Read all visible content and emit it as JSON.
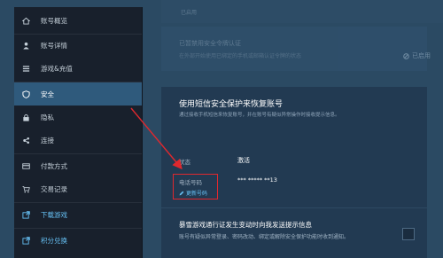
{
  "sidebar": {
    "items": [
      {
        "label": "账号概览",
        "icon": "home-icon"
      },
      {
        "label": "账号详情",
        "icon": "user-icon"
      },
      {
        "label": "游戏&充值",
        "icon": "list-icon"
      },
      {
        "label": "安全",
        "icon": "shield-icon"
      },
      {
        "label": "隐私",
        "icon": "lock-icon"
      },
      {
        "label": "连接",
        "icon": "link-icon"
      },
      {
        "label": "付款方式",
        "icon": "card-icon"
      },
      {
        "label": "交易记录",
        "icon": "cart-icon"
      },
      {
        "label": "下载游戏",
        "icon": "external-link-icon"
      },
      {
        "label": "积分兑换",
        "icon": "external-link-icon"
      }
    ],
    "active": "安全"
  },
  "background": {
    "top_label": "已启用",
    "card_title": "已暂禁用安全令牌认证",
    "card_sub": "在外部开始使用已绑定的手机或邮箱认证令牌的状态",
    "status": "已启用"
  },
  "recovery": {
    "title": "使用短信安全保护来恢复账号",
    "subtitle": "通过接收手机短信来恢复账号，并在账号有疑似异常操作时接收提示信息。",
    "status_label": "状态",
    "status_value": "激活",
    "phone_label": "电话号码",
    "phone_value": "*** ***** **13",
    "edit_label": "更新号码"
  },
  "notify": {
    "title": "暴雪游戏通行证发生变动时向我发送提示信息",
    "desc": "账号有疑似异常登录、密码改动、绑定或解除安全保护功能时收到通知。"
  },
  "colors": {
    "accent": "#66c0f4",
    "highlight": "#e0282e",
    "sidebar_bg": "#18202c",
    "active_bg": "#2f5a7c"
  }
}
